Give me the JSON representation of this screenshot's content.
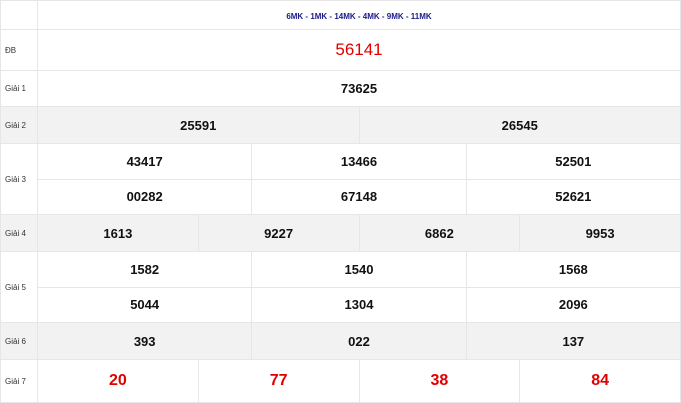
{
  "header": {
    "codes": "6MK - 1MK - 14MK - 4MK - 9MK - 11MK"
  },
  "rows": {
    "db": {
      "label": "ĐB",
      "values": [
        "56141"
      ]
    },
    "g1": {
      "label": "Giải 1",
      "values": [
        "73625"
      ]
    },
    "g2": {
      "label": "Giải 2",
      "values": [
        "25591",
        "26545"
      ]
    },
    "g3": {
      "label": "Giải 3",
      "values": [
        "43417",
        "13466",
        "52501",
        "00282",
        "67148",
        "52621"
      ]
    },
    "g4": {
      "label": "Giải 4",
      "values": [
        "1613",
        "9227",
        "6862",
        "9953"
      ]
    },
    "g5": {
      "label": "Giải 5",
      "values": [
        "1582",
        "1540",
        "1568",
        "5044",
        "1304",
        "2096"
      ]
    },
    "g6": {
      "label": "Giải 6",
      "values": [
        "393",
        "022",
        "137"
      ]
    },
    "g7": {
      "label": "Giải 7",
      "values": [
        "20",
        "77",
        "38",
        "84"
      ]
    }
  },
  "colors": {
    "special": "#e00000",
    "header": "#1a1a8c",
    "shade": "#f2f2f2"
  }
}
